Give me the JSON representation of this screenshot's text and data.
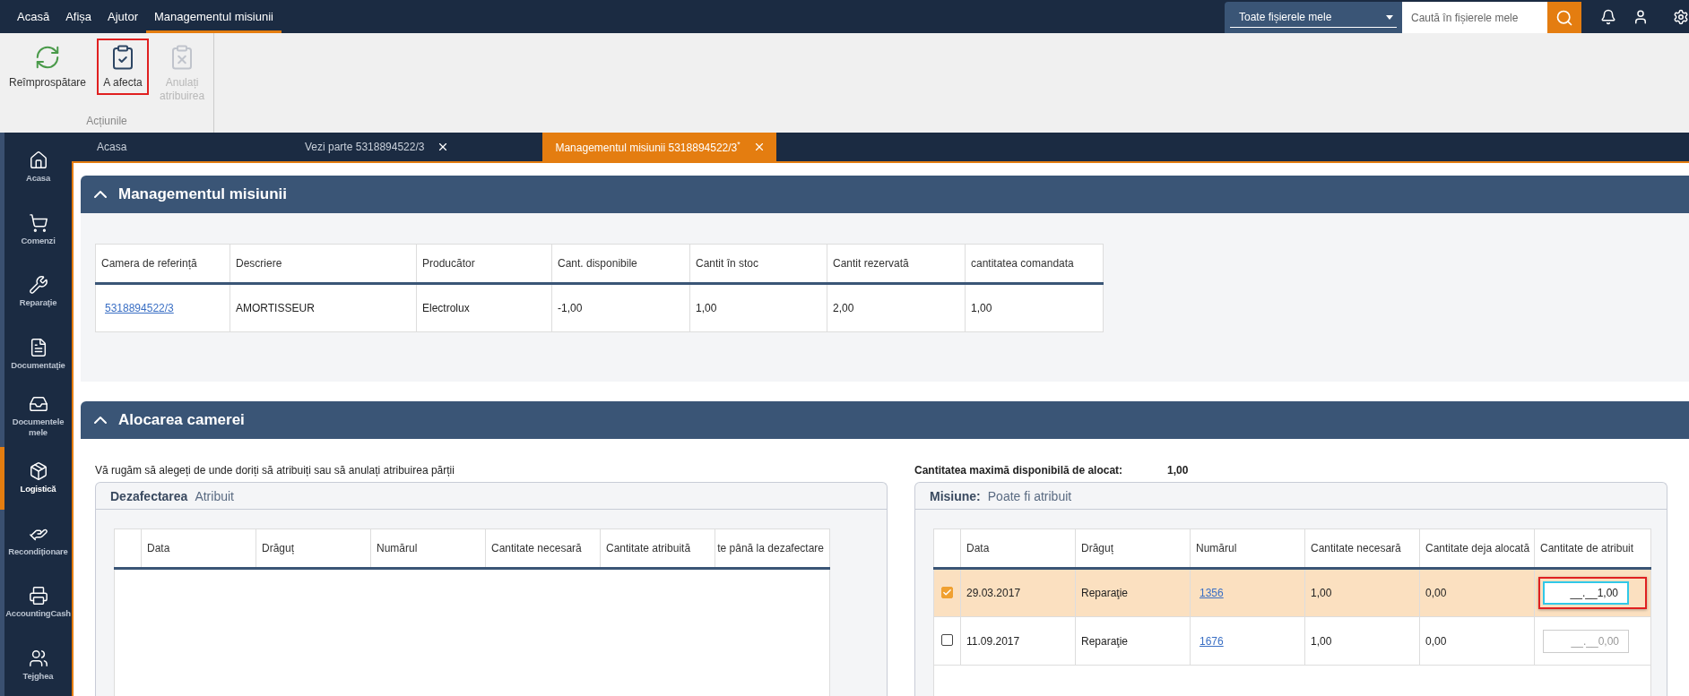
{
  "menu": [
    {
      "label": "Acasă",
      "selected": false
    },
    {
      "label": "Afișa",
      "selected": false
    },
    {
      "label": "Ajutor",
      "selected": false
    },
    {
      "label": "Managementul misiunii",
      "selected": true
    }
  ],
  "scope_dropdown": {
    "value": "Toate fișierele mele"
  },
  "search": {
    "placeholder": "Caută în fișierele mele"
  },
  "ribbon": {
    "group_label": "Acțiunile",
    "buttons": [
      {
        "kind": "refresh",
        "label": "Reîmprospătare",
        "disabled": false,
        "highlighted": false
      },
      {
        "kind": "assign",
        "label": "A afecta",
        "disabled": false,
        "highlighted": true
      },
      {
        "kind": "unassign",
        "label": "Anulați atribuirea",
        "disabled": true,
        "highlighted": false
      }
    ]
  },
  "sidebar": {
    "items": [
      {
        "kind": "home",
        "label": "Acasa",
        "selected": false
      },
      {
        "kind": "cart",
        "label": "Comenzi",
        "selected": false
      },
      {
        "kind": "wrench",
        "label": "Reparaţie",
        "selected": false
      },
      {
        "kind": "doc",
        "label": "Documentaţie",
        "selected": false
      },
      {
        "kind": "inbox",
        "label": "Documentele mele",
        "selected": false
      },
      {
        "kind": "dolly",
        "label": "Logistică",
        "selected": true
      },
      {
        "kind": "gear-hand",
        "label": "Recondiționare",
        "selected": false
      },
      {
        "kind": "register",
        "label": "AccountingCash",
        "selected": false
      },
      {
        "kind": "people",
        "label": "Tejghea",
        "selected": false
      }
    ]
  },
  "tabs": [
    {
      "label": "Acasa",
      "selected": false,
      "closable": false
    },
    {
      "label": "Vezi parte 5318894522/3",
      "selected": false,
      "closable": true
    },
    {
      "label": "Managementul misiunii 5318894522/3$^{*}$",
      "selected": true,
      "closable": true
    }
  ],
  "part_section": {
    "title": "Managementul misiunii",
    "expanded": true,
    "columns": [
      "Camera de referință",
      "Descriere",
      "Producător",
      "Cant. disponibile",
      "Cantit în stoc",
      "Cantit rezervată",
      "cantitatea comandata"
    ],
    "rows": [
      {
        "cells": [
          {
            "kind": "link",
            "text": "5318894522/3"
          },
          {
            "kind": "text",
            "text": "AMORTISSEUR"
          },
          {
            "kind": "text",
            "text": "Electrolux"
          },
          {
            "kind": "text",
            "text": "-1,00"
          },
          {
            "kind": "text",
            "text": "1,00"
          },
          {
            "kind": "text",
            "text": "2,00"
          },
          {
            "kind": "text",
            "text": "1,00"
          }
        ]
      }
    ]
  },
  "allocation_section": {
    "title": "Alocarea camerei",
    "expanded": true,
    "instruction": "Vă rugăm să alegeți de unde doriți să atribuiți sau să anulați atribuirea părții",
    "max_label": "Cantitatea maximă disponibilă de alocat:",
    "max_value": "1,00",
    "dismantling_panel": {
      "title": "Dezafectarea",
      "subtitle": "Atribuit",
      "columns": [
        "Data",
        "Drăguț",
        "Numărul",
        "Cantitate necesară",
        "Cantitate atribuită",
        "te până la dezafectare"
      ]
    },
    "mission_panel": {
      "title": "Misiune:",
      "subtitle": "Poate fi atribuit",
      "columns": [
        "Data",
        "Drăguț",
        "Numărul",
        "Cantitate necesară",
        "Cantitate deja alocată",
        "Cantitate de atribuit"
      ],
      "rows": [
        {
          "checked": true,
          "selected": true,
          "cells": [
            {
              "kind": "text",
              "text": "29.03.2017"
            },
            {
              "kind": "text",
              "text": "Reparaţie"
            },
            {
              "kind": "link",
              "text": "1356"
            },
            {
              "kind": "text",
              "text": "1,00"
            },
            {
              "kind": "text",
              "text": "0,00"
            }
          ],
          "quantity": {
            "value": "__.__1,00",
            "highlighted": true
          }
        },
        {
          "checked": false,
          "selected": false,
          "cells": [
            {
              "kind": "text",
              "text": "11.09.2017"
            },
            {
              "kind": "text",
              "text": "Reparaţie"
            },
            {
              "kind": "link",
              "text": "1676"
            },
            {
              "kind": "text",
              "text": "1,00"
            },
            {
              "kind": "text",
              "text": "0,00"
            }
          ],
          "quantity": {
            "placeholder": "__.__0,00",
            "highlighted": false
          }
        }
      ]
    }
  }
}
